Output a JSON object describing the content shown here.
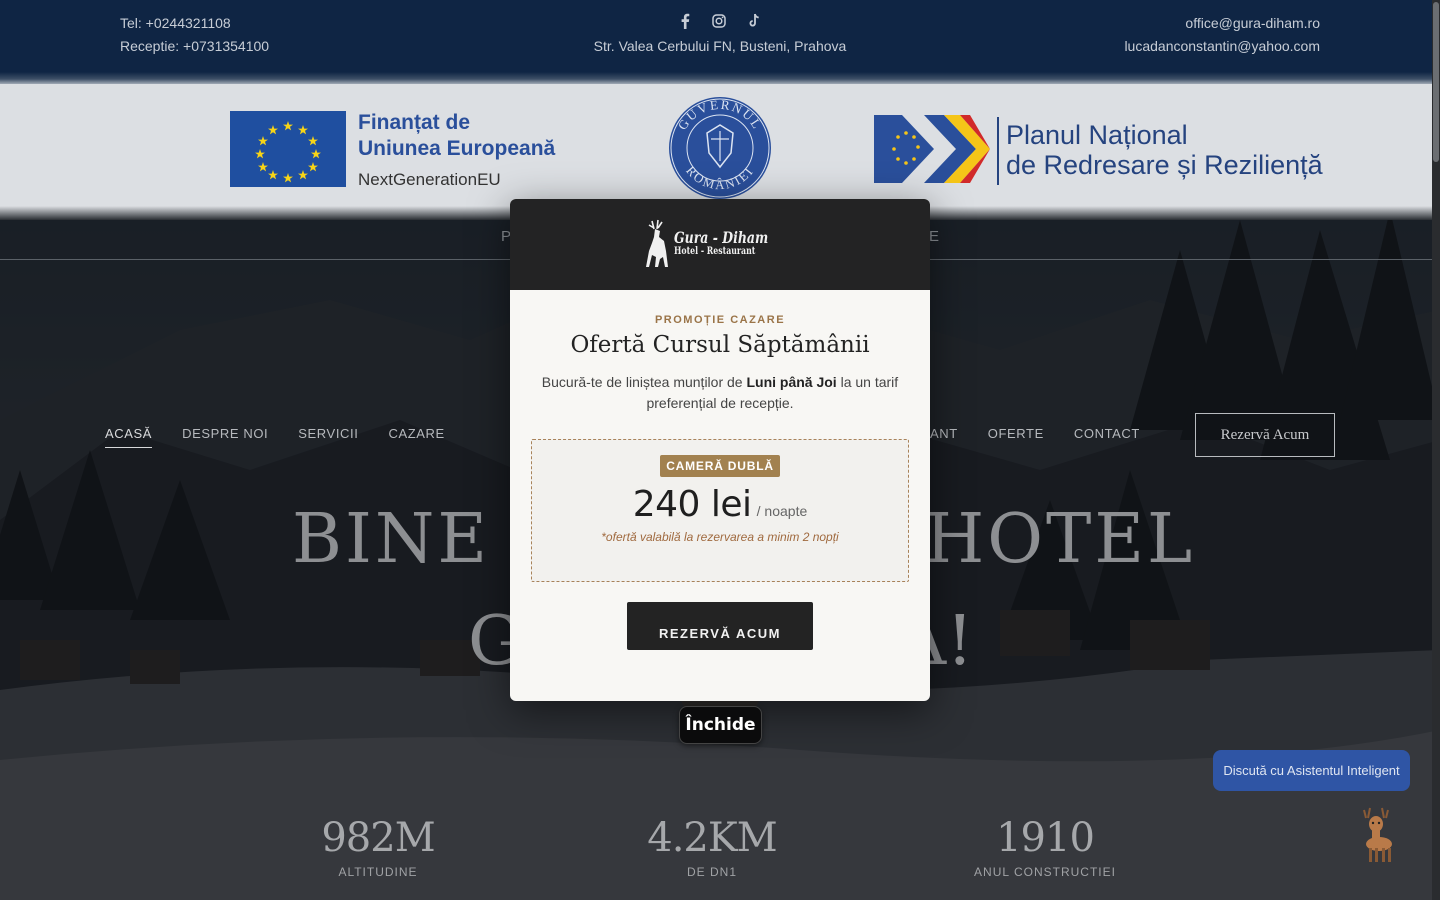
{
  "topbar": {
    "tel": "Tel: +0244321108",
    "receptie": "Receptie: +0731354100",
    "address": "Str. Valea Cerbului FN, Busteni, Prahova",
    "email1": "office@gura-diham.ro",
    "email2": "lucadanconstantin@yahoo.com",
    "social_icons": [
      "facebook-icon",
      "instagram-icon",
      "tiktok-icon"
    ]
  },
  "funding": {
    "eu_line1": "Finanțat de",
    "eu_line2": "Uniunea Europeană",
    "eu_line3": "NextGenerationEU",
    "gov_top": "GUVERNUL",
    "gov_bottom": "ROMÂNIEI",
    "pnrr_line1": "Planul Național",
    "pnrr_line2": "de Redresare și Reziliență"
  },
  "subnav": {
    "left_fragment": "P",
    "right_fragment": "E"
  },
  "nav": {
    "left": [
      "ACASĂ",
      "DESPRE NOI",
      "SERVICII",
      "CAZARE"
    ],
    "right": [
      "URANT",
      "OFERTE",
      "CONTACT"
    ],
    "cta": "Rezervă Acum"
  },
  "hero": {
    "l1_left": "BINE A",
    "l1_right": "HOTEL",
    "l2_left": "G",
    "l2_right": "A!"
  },
  "stats": [
    {
      "num": "982M",
      "label": "ALTITUDINE"
    },
    {
      "num": "4.2KM",
      "label": "DE DN1"
    },
    {
      "num": "1910",
      "label": "ANUL CONSTRUCTIEI"
    }
  ],
  "chat": {
    "label": "Discută cu Asistentul Inteligent"
  },
  "modal": {
    "logo_line1": "Gura - Diham",
    "logo_line2": "Hotel - Restaurant",
    "eyebrow": "PROMOȚIE CAZARE",
    "title": "Ofertă Cursul Săptămânii",
    "desc_pre": "Bucură-te de liniștea munților de ",
    "desc_bold": "Luni până Joi",
    "desc_post": " la un tarif preferențial de recepție.",
    "room_type": "CAMERĂ DUBLĂ",
    "price": "240 lei",
    "unit": "/ noapte",
    "fine_print": "*ofertă valabilă la rezervarea a minim 2 nopți",
    "book_button": "REZERVĂ ACUM",
    "close_button": "Închide"
  },
  "colors": {
    "topbar": "#0f2544",
    "modal_accent": "#a2814f",
    "chat": "#2f55a5"
  }
}
